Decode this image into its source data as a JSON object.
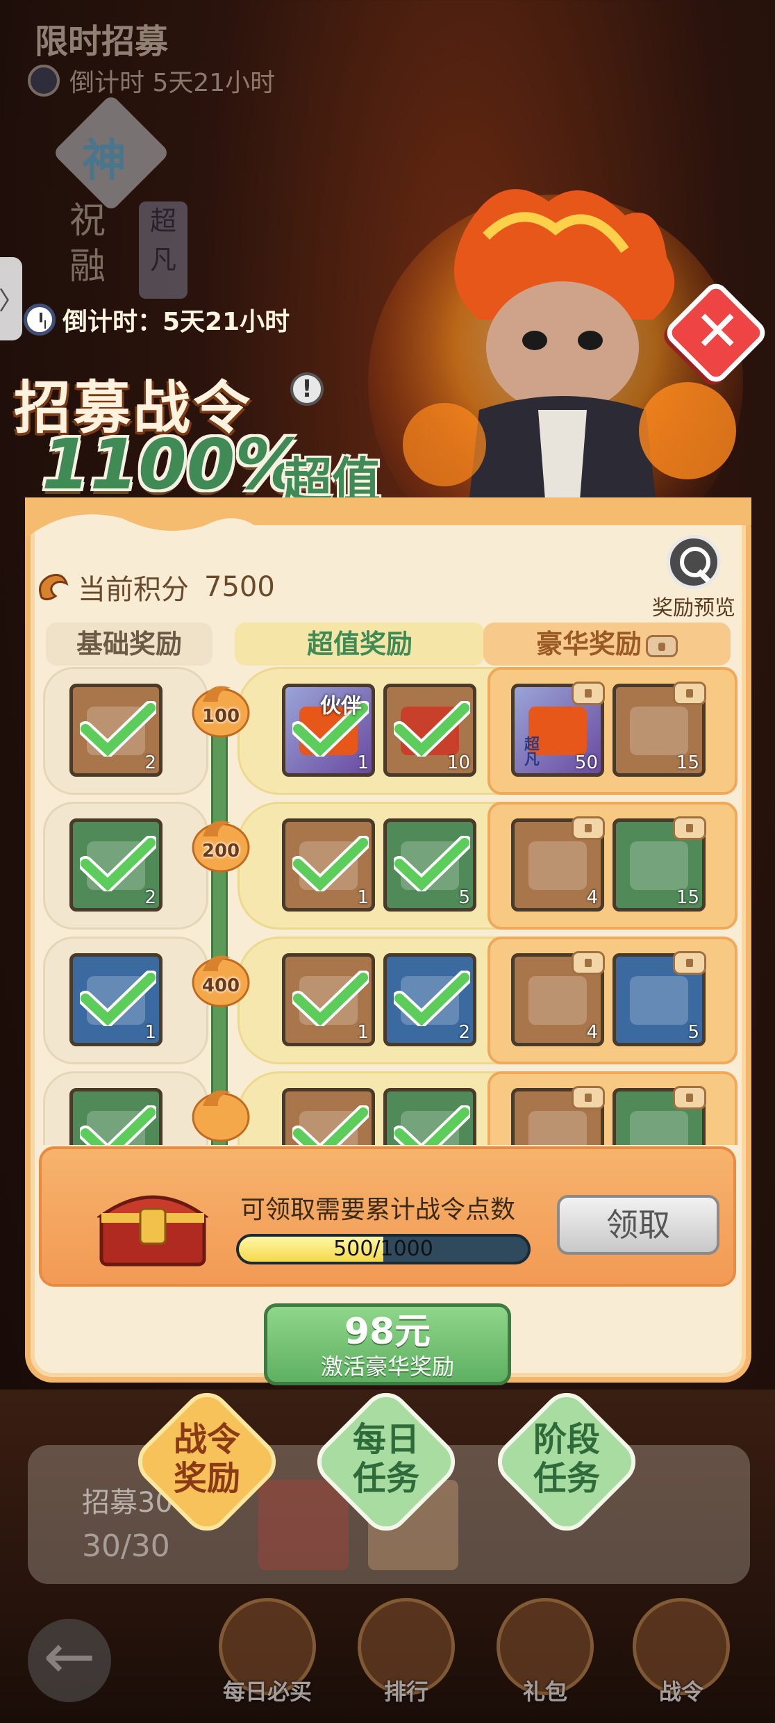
{
  "background": {
    "title": "限时招募",
    "timer": "倒计时 5天21小时",
    "shen": "神",
    "vertical": "祝融",
    "chaofan": "超凡",
    "lower_label1": "招募30",
    "lower_label2": "30/30"
  },
  "header": {
    "timer": "倒计时：5天21小时",
    "title": "招募战令",
    "info_icon": "!",
    "value": "1100%",
    "value_suffix": "超值",
    "close_icon": "close-icon"
  },
  "panel": {
    "score_label": "当前积分",
    "score_value": "7500",
    "preview_label": "奖励预览",
    "columns": {
      "basic": "基础奖励",
      "super": "超值奖励",
      "luxury": "豪华奖励"
    },
    "rows": [
      {
        "milestone": "100",
        "basic": {
          "count": "2",
          "claimed": true
        },
        "super": [
          {
            "tag": "伙伴",
            "count": "1",
            "claimed": true
          },
          {
            "count": "10",
            "claimed": true
          }
        ],
        "luxury": [
          {
            "count": "50"
          },
          {
            "count": "15"
          }
        ]
      },
      {
        "milestone": "200",
        "basic": {
          "count": "2",
          "claimed": true
        },
        "super": [
          {
            "count": "1",
            "claimed": true
          },
          {
            "count": "5",
            "claimed": true
          }
        ],
        "luxury": [
          {
            "count": "4"
          },
          {
            "count": "15"
          }
        ]
      },
      {
        "milestone": "400",
        "basic": {
          "count": "1",
          "claimed": true
        },
        "super": [
          {
            "count": "1",
            "claimed": true
          },
          {
            "count": "2",
            "claimed": true
          }
        ],
        "luxury": [
          {
            "count": "4"
          },
          {
            "count": "5"
          }
        ]
      },
      {
        "milestone": "",
        "basic": {
          "count": "",
          "claimed": true
        },
        "super": [
          {
            "count": "",
            "claimed": true
          },
          {
            "count": "",
            "claimed": true
          }
        ],
        "luxury": [
          {
            "count": ""
          },
          {
            "count": ""
          }
        ]
      }
    ],
    "hero_item_label": "超凡",
    "claim": {
      "text": "可领取需要累计战令点数",
      "progress_label": "500/1000",
      "progress": 0.5,
      "button": "领取"
    },
    "buy": {
      "price": "98元",
      "subtitle": "激活豪华奖励"
    }
  },
  "tabs": [
    {
      "label_top": "战令",
      "label_bottom": "奖励",
      "active": true
    },
    {
      "label_top": "每日",
      "label_bottom": "任务",
      "active": false
    },
    {
      "label_top": "阶段",
      "label_bottom": "任务",
      "active": false
    }
  ],
  "bottom_nav": [
    "每日必买",
    "排行",
    "礼包",
    "战令"
  ],
  "colors": {
    "accent_green": "#3f8a55",
    "panel_border": "#f3b66a",
    "close_red": "#e44"
  }
}
